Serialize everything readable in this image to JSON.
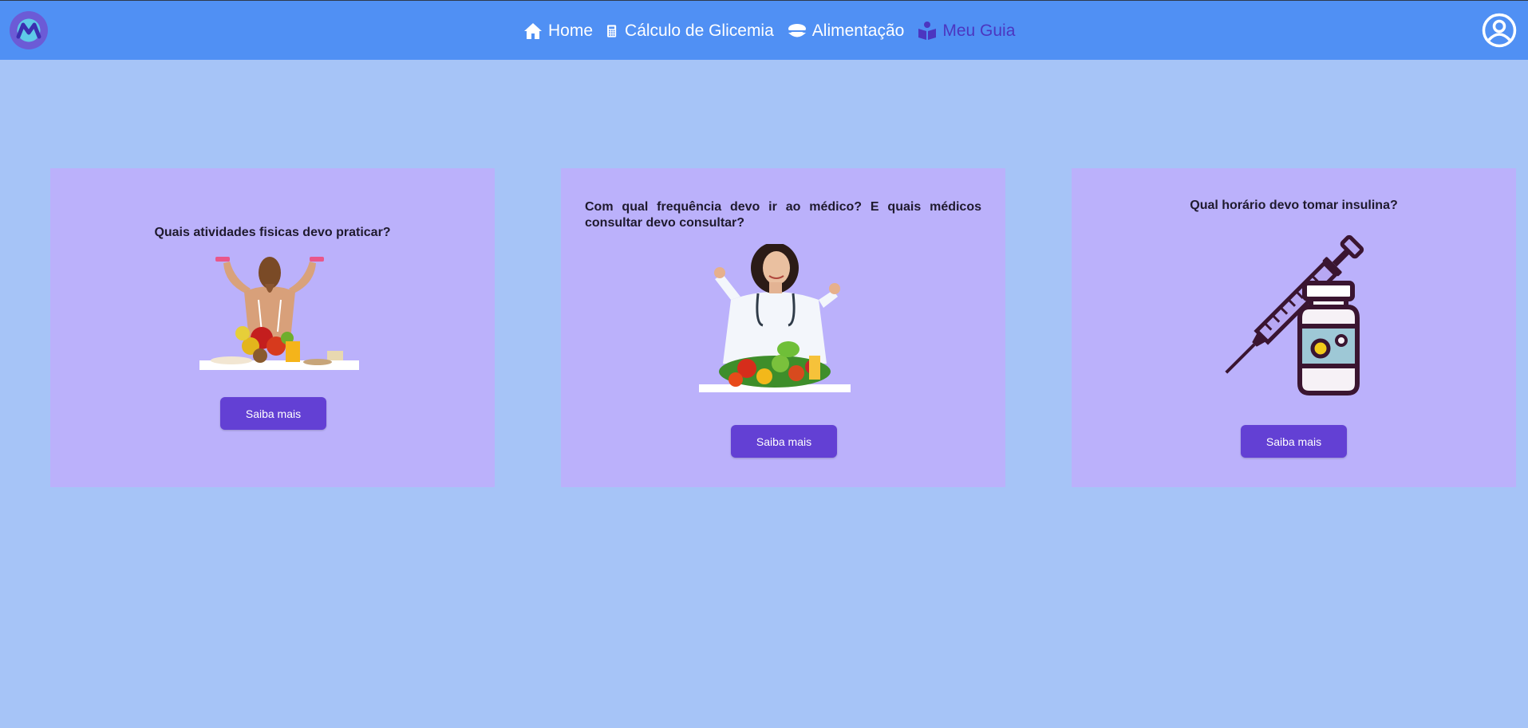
{
  "header": {
    "nav": [
      {
        "label": "Home",
        "icon": "home-icon"
      },
      {
        "label": "Cálculo de Glicemia",
        "icon": "calculator-icon"
      },
      {
        "label": "Alimentação",
        "icon": "bowl-icon"
      },
      {
        "label": "Meu Guia",
        "icon": "book-reader-icon",
        "active": true
      }
    ]
  },
  "cards": [
    {
      "title": "Quais atividades fisicas devo praticar?",
      "button": "Saiba mais"
    },
    {
      "title": "Com qual frequência devo ir ao médico? E quais médicos consultar devo consultar?",
      "button": "Saiba mais"
    },
    {
      "title": "Qual horário devo tomar insulina?",
      "button": "Saiba mais"
    }
  ],
  "colors": {
    "page_bg": "#a6c4f7",
    "header_bg": "#5090f4",
    "card_bg": "#bbb1fb",
    "button_bg": "#6340d4",
    "active_nav": "#4c36c0"
  }
}
